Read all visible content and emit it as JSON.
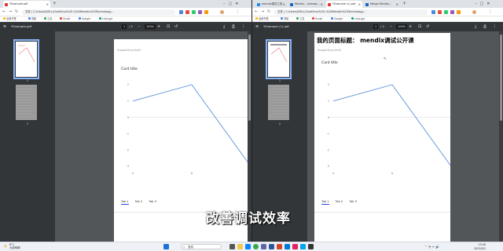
{
  "left_window": {
    "tabs": [
      {
        "label": "YExample.pdf",
        "active": true
      }
    ],
    "url": "文件 | C:/Users/DELL/OneDrive%20-%20Mendix%20Technology...",
    "bookmarks": [
      "全部书签",
      "导航",
      "工具",
      "Gmail",
      "Google",
      "chat.gpt"
    ],
    "pdf": {
      "title": "YExample.pdf",
      "page_current": "1",
      "page_total": "/ 2",
      "zoom": "100%",
      "thumb_labels": [
        "1",
        "2"
      ],
      "subtitle": "Supporting text2",
      "card_title": "Card title",
      "tabs": [
        "Tab 1",
        "Tab 2",
        "Tab 3"
      ]
    }
  },
  "right_window": {
    "tabs": [
      {
        "label": "mendix调试工具",
        "active": false
      },
      {
        "label": "Mendix – Interap...",
        "active": false
      },
      {
        "label": "YExample (1).pdf",
        "active": true
      },
      {
        "label": "Merge Mendix...",
        "active": false
      }
    ],
    "url": "文件 | C:/Users/DELL/OneDrive%20-%20Mendix%20Technology...",
    "bookmarks": [
      "全部书签",
      "导航",
      "工具",
      "Gmail",
      "Google",
      "chat.gpt"
    ],
    "pdf": {
      "title": "YExample (1).pdf",
      "page_current": "1",
      "page_total": "/ 2",
      "zoom": "100%",
      "thumb_labels": [
        "1",
        "2"
      ],
      "heading": "我的页面标题： mendix调试公开课",
      "subtitle": "Supporting text2",
      "card_title": "Card title",
      "tabs": [
        "Tab 1",
        "Tab 2",
        "Tab 3"
      ]
    }
  },
  "caption": "改善调试效率",
  "taskbar": {
    "weather_temp": "8°C",
    "weather_desc": "大部晴朗",
    "search_placeholder": "搜索",
    "tray_time": "13:08",
    "tray_date": "2023/8/3"
  },
  "chart_data": {
    "type": "line",
    "x": [
      "a",
      "b",
      "c"
    ],
    "y_ticks": [
      2,
      1,
      0,
      -1,
      -2,
      -3
    ],
    "x_ticks": [
      "a",
      "b"
    ],
    "ylim": [
      -3,
      2
    ],
    "series": [
      {
        "values": [
          1,
          2,
          -3
        ]
      }
    ],
    "colors": {
      "line": "#5b8fd6"
    }
  }
}
